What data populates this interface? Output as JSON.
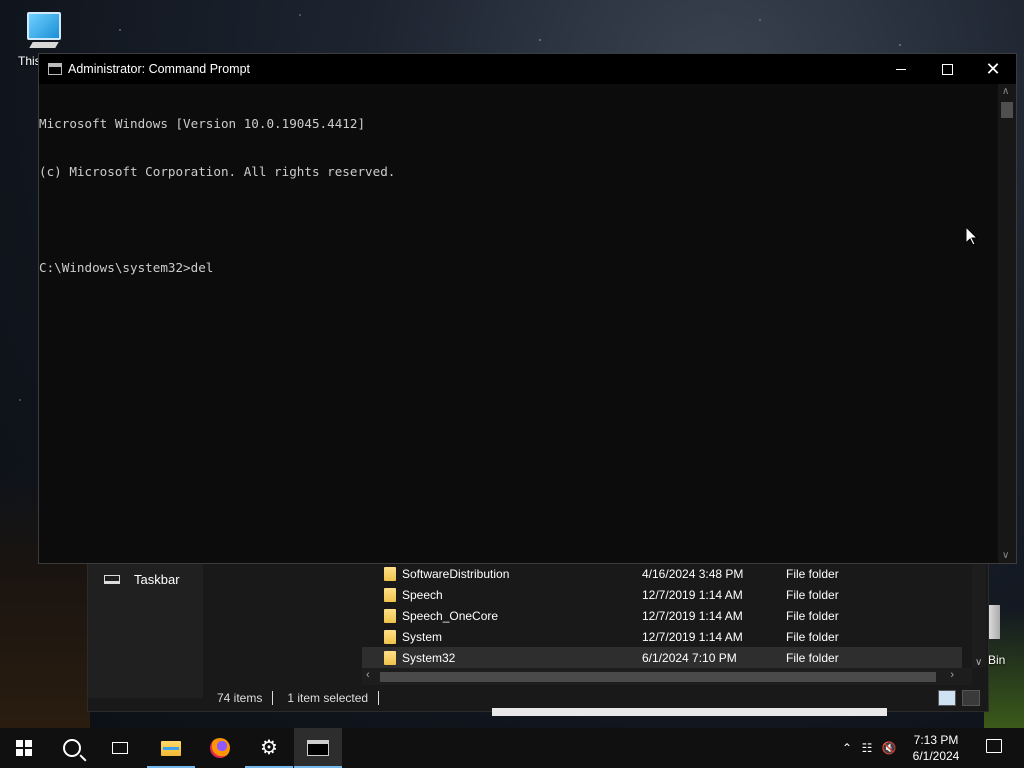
{
  "desktop": {
    "icons": [
      {
        "label": "This"
      },
      {
        "label": "Bin"
      }
    ]
  },
  "explorer": {
    "nav_item": "Taskbar",
    "files": [
      {
        "name": "SoftwareDistribution",
        "date": "4/16/2024 3:48 PM",
        "type": "File folder"
      },
      {
        "name": "Speech",
        "date": "12/7/2019 1:14 AM",
        "type": "File folder"
      },
      {
        "name": "Speech_OneCore",
        "date": "12/7/2019 1:14 AM",
        "type": "File folder"
      },
      {
        "name": "System",
        "date": "12/7/2019 1:14 AM",
        "type": "File folder"
      },
      {
        "name": "System32",
        "date": "6/1/2024 7:10 PM",
        "type": "File folder"
      }
    ],
    "status": {
      "items": "74 items",
      "selected": "1 item selected"
    }
  },
  "cmd": {
    "title": "Administrator: Command Prompt",
    "lines": [
      "Microsoft Windows [Version 10.0.19045.4412]",
      "(c) Microsoft Corporation. All rights reserved.",
      "",
      "C:\\Windows\\system32>del"
    ]
  },
  "taskbar": {
    "time": "7:13 PM",
    "date": "6/1/2024"
  },
  "colors": {
    "accent": "#76b9ed",
    "console_bg": "#0c0c0c",
    "console_text": "#cccccc"
  }
}
